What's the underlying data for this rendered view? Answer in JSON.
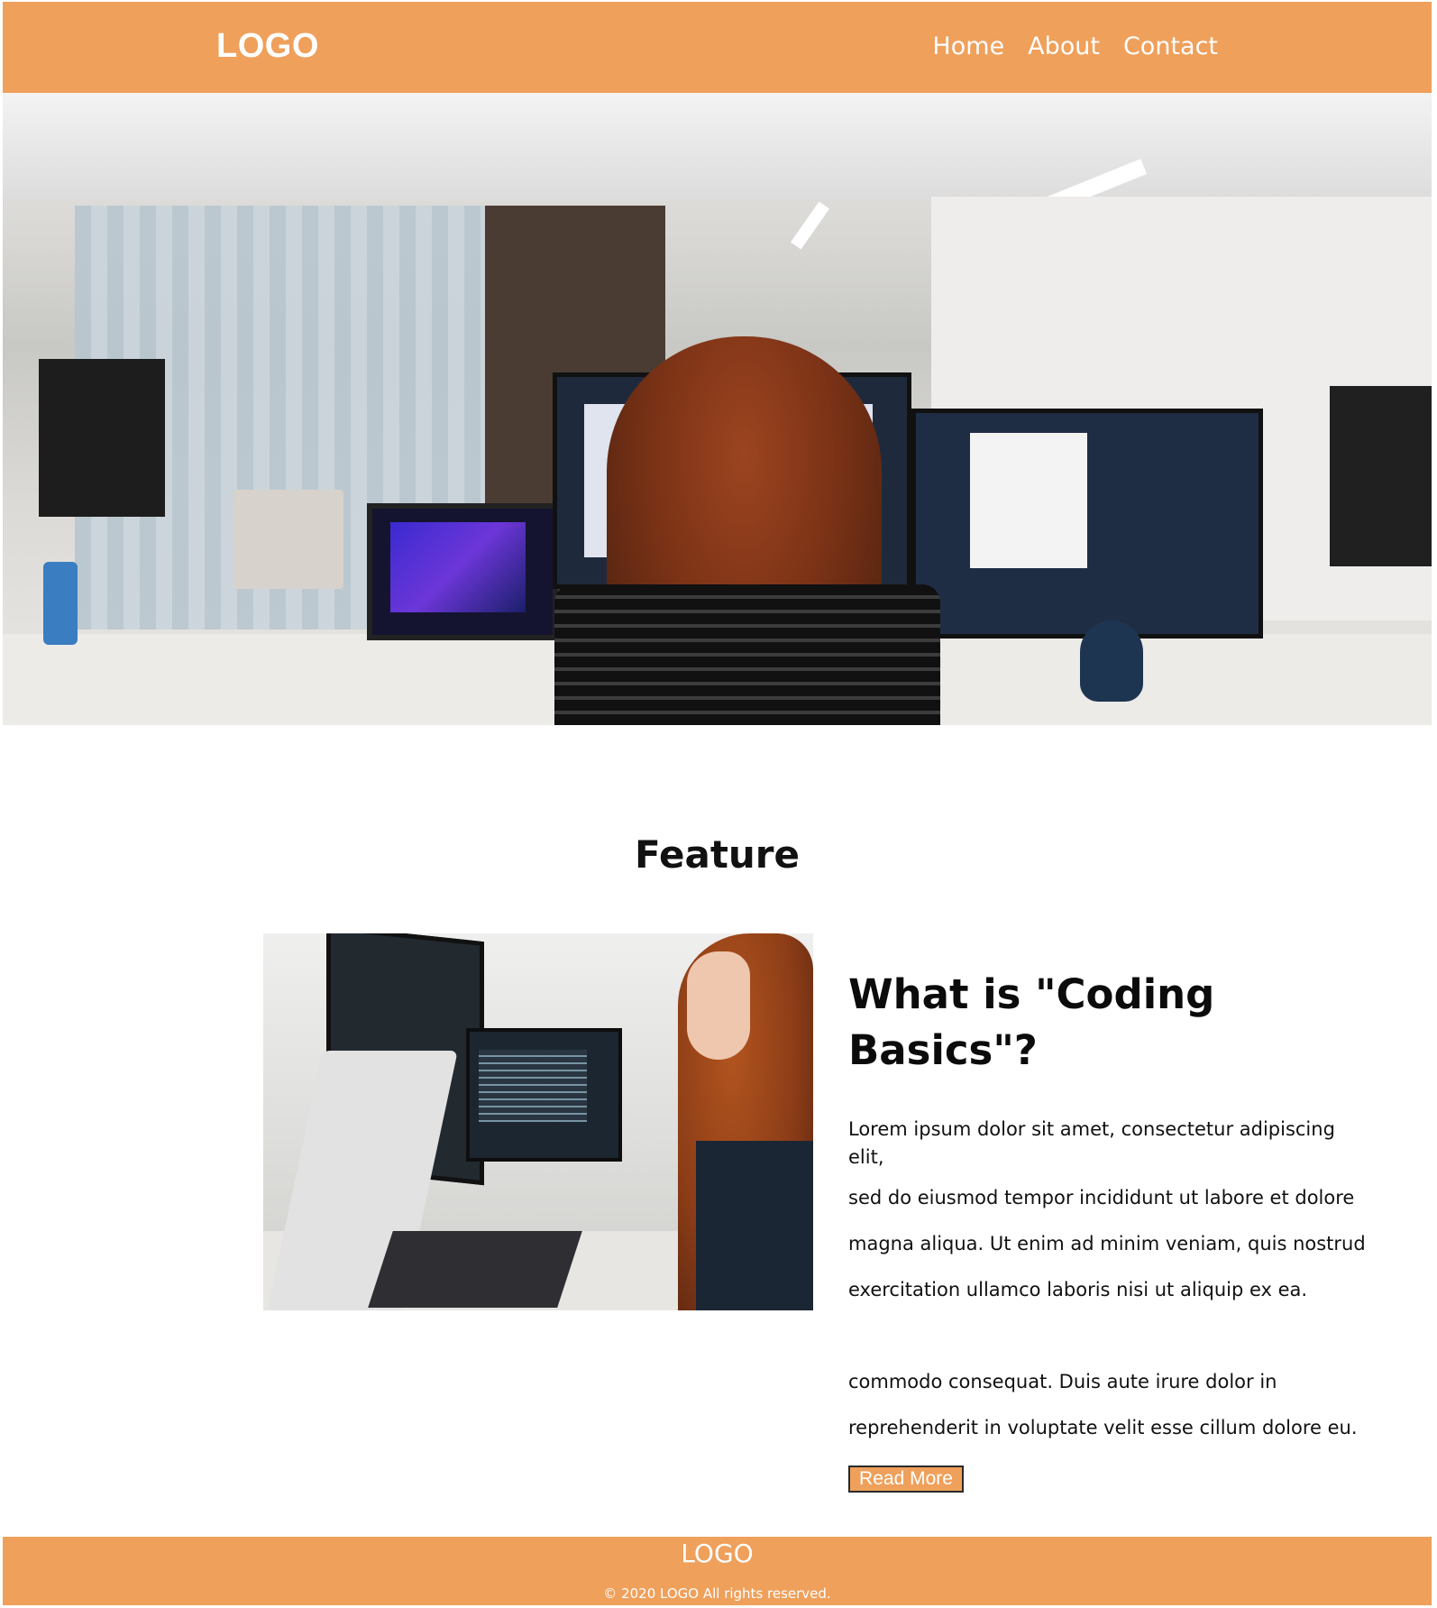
{
  "header": {
    "logo": "LOGO",
    "nav": [
      "Home",
      "About",
      "Contact"
    ]
  },
  "feature": {
    "section_title": "Feature",
    "heading": "What is \"Coding Basics\"?",
    "paragraphs": [
      "Lorem ipsum dolor sit amet, consectetur adipiscing elit,",
      "sed do eiusmod tempor incididunt ut labore et dolore",
      "magna aliqua. Ut enim ad minim veniam, quis nostrud",
      "exercitation ullamco laboris nisi ut aliquip ex ea.",
      "commodo consequat. Duis aute irure dolor in",
      "reprehenderit in voluptate velit esse cillum dolore eu."
    ],
    "button_label": "Read More"
  },
  "footer": {
    "logo": "LOGO",
    "copyright": "© 2020 LOGO All rights reserved."
  },
  "colors": {
    "brand": "#EFA05B",
    "text": "#111111"
  }
}
